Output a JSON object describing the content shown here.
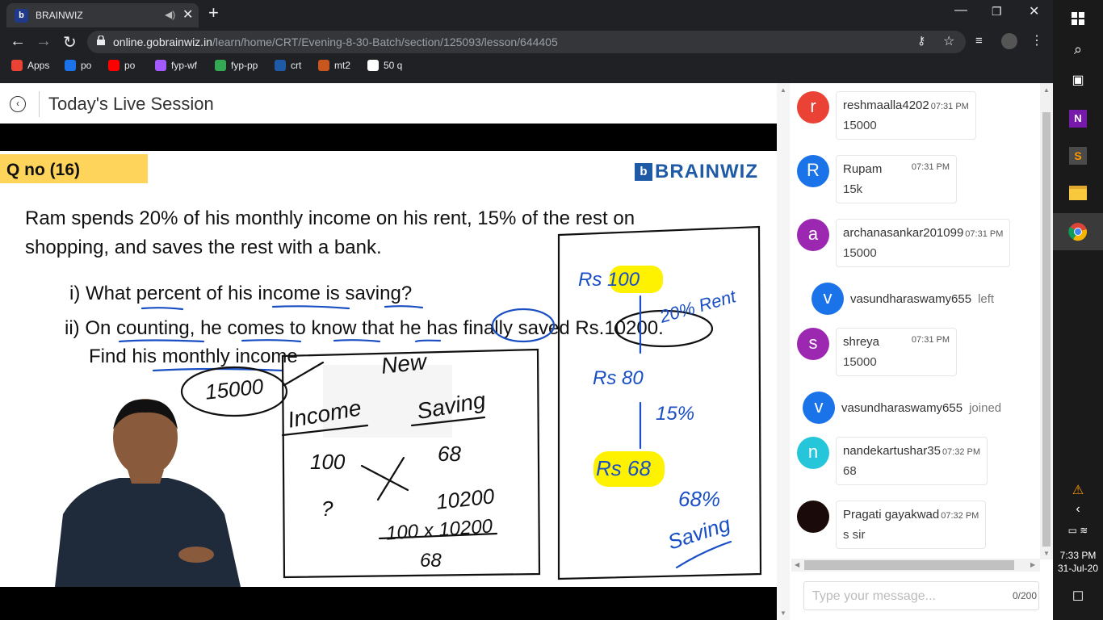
{
  "browser": {
    "tab_title": "BRAINWIZ",
    "url_host": "online.gobrainwiz.in",
    "url_path": "/learn/home/CRT/Evening-8-30-Batch/section/125093/lesson/644405",
    "bookmarks": [
      {
        "label": "Apps",
        "color": "#ea4335"
      },
      {
        "label": "po",
        "color": "#1a73e8"
      },
      {
        "label": "po",
        "color": "#ff0000"
      },
      {
        "label": "fyp-wf",
        "color": "#a259ff"
      },
      {
        "label": "fyp-pp",
        "color": "#34a853"
      },
      {
        "label": "crt",
        "color": "#1f5aa6"
      },
      {
        "label": "mt2",
        "color": "#c8561f"
      },
      {
        "label": "50 q",
        "color": "#ffffff"
      }
    ]
  },
  "page": {
    "title": "Today's Live Session"
  },
  "slide": {
    "qno": "Q no (16)",
    "logo": "BRAINWIZ",
    "lines": [
      "Ram spends 20% of his monthly income on his rent, 15% of the rest on",
      "shopping, and saves the rest with a bank.",
      "i) What percent of his income is saving?",
      "ii) On counting, he comes to know that he has finally saved Rs.10200.",
      "Find his monthly income"
    ],
    "handwriting": {
      "circled": "15000",
      "new": "New",
      "income": "Income",
      "saving": "Saving",
      "r1a": "100",
      "r1b": "68",
      "r2a": "?",
      "r2b": "10200",
      "calc": "100 x 10200",
      "denom": "68",
      "rs100": "Rs 100",
      "rent": "20% Rent",
      "rs80": "Rs 80",
      "p15": "15%",
      "rs68": "Rs 68",
      "p68": "68%",
      "saving2": "Saving"
    }
  },
  "chat": {
    "messages": [
      {
        "initial": "r",
        "color": "#ea4335",
        "name": "reshmaalla4202",
        "time": "07:31 PM",
        "text": "15000"
      },
      {
        "initial": "R",
        "color": "#1a73e8",
        "name": "Rupam",
        "time": "07:31 PM",
        "text": "15k"
      },
      {
        "initial": "a",
        "color": "#9c27b0",
        "name": "archanasankar201099",
        "time": "07:31 PM",
        "text": "15000"
      },
      {
        "initial": "s",
        "color": "#9c27b0",
        "name": "shreya",
        "time": "07:31 PM",
        "text": "15000"
      },
      {
        "initial": "n",
        "color": "#26c6da",
        "name": "nandekartushar35",
        "time": "07:32 PM",
        "text": "68"
      },
      {
        "initial": "",
        "color": "#1a0a0a",
        "name": "Pragati gayakwad",
        "time": "07:32 PM",
        "text": "s sir"
      }
    ],
    "events": [
      {
        "initial": "v",
        "name": "vasundharaswamy655",
        "action": "left"
      },
      {
        "initial": "v",
        "name": "vasundharaswamy655",
        "action": "joined"
      }
    ],
    "input_placeholder": "Type your message...",
    "char_count": "0/200"
  },
  "taskbar": {
    "time": "7:33 PM",
    "date": "31-Jul-20"
  }
}
